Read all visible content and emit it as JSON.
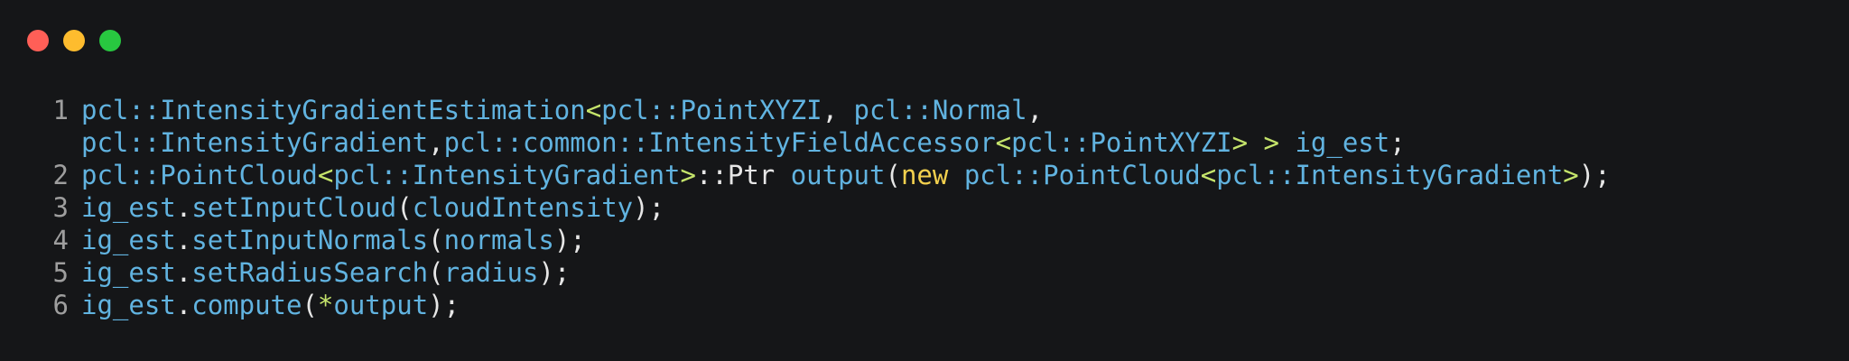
{
  "window": {
    "traffic_lights": [
      {
        "name": "close",
        "color": "#ff5f57"
      },
      {
        "name": "minimize",
        "color": "#febc2e"
      },
      {
        "name": "maximize",
        "color": "#28c840"
      }
    ]
  },
  "colors": {
    "background": "#151618",
    "line_number": "#9e9e9e",
    "identifier": "#61b3e0",
    "punctuation": "#e6e6e6",
    "angle": "#c5e46b",
    "keyword": "#f2d04e",
    "operator": "#c5e46b"
  },
  "code": {
    "lines": [
      {
        "number": "1",
        "tokens": [
          {
            "t": "pcl::IntensityGradientEstimation",
            "c": "identifier"
          },
          {
            "t": "<",
            "c": "angle"
          },
          {
            "t": "pcl::PointXYZI",
            "c": "identifier"
          },
          {
            "t": ", ",
            "c": "punctuation"
          },
          {
            "t": "pcl::Normal",
            "c": "identifier"
          },
          {
            "t": ",",
            "c": "punctuation"
          }
        ]
      },
      {
        "number": "",
        "tokens": [
          {
            "t": "pcl::IntensityGradient",
            "c": "identifier"
          },
          {
            "t": ",",
            "c": "punctuation"
          },
          {
            "t": "pcl::common::IntensityFieldAccessor",
            "c": "identifier"
          },
          {
            "t": "<",
            "c": "angle"
          },
          {
            "t": "pcl::PointXYZI",
            "c": "identifier"
          },
          {
            "t": ">",
            "c": "angle"
          },
          {
            "t": " ",
            "c": "punctuation"
          },
          {
            "t": ">",
            "c": "angle"
          },
          {
            "t": " ",
            "c": "punctuation"
          },
          {
            "t": "ig_est",
            "c": "identifier"
          },
          {
            "t": ";",
            "c": "punctuation"
          }
        ]
      },
      {
        "number": "2",
        "tokens": [
          {
            "t": "pcl::PointCloud",
            "c": "identifier"
          },
          {
            "t": "<",
            "c": "angle"
          },
          {
            "t": "pcl::IntensityGradient",
            "c": "identifier"
          },
          {
            "t": ">",
            "c": "angle"
          },
          {
            "t": "::Ptr ",
            "c": "punctuation"
          },
          {
            "t": "output",
            "c": "identifier"
          },
          {
            "t": "(",
            "c": "punctuation"
          },
          {
            "t": "new",
            "c": "keyword"
          },
          {
            "t": " ",
            "c": "punctuation"
          },
          {
            "t": "pcl::PointCloud",
            "c": "identifier"
          },
          {
            "t": "<",
            "c": "angle"
          },
          {
            "t": "pcl::IntensityGradient",
            "c": "identifier"
          },
          {
            "t": ">",
            "c": "angle"
          },
          {
            "t": ");",
            "c": "punctuation"
          }
        ]
      },
      {
        "number": "3",
        "tokens": [
          {
            "t": "ig_est",
            "c": "identifier"
          },
          {
            "t": ".",
            "c": "punctuation"
          },
          {
            "t": "setInputCloud",
            "c": "identifier"
          },
          {
            "t": "(",
            "c": "punctuation"
          },
          {
            "t": "cloudIntensity",
            "c": "identifier"
          },
          {
            "t": ");",
            "c": "punctuation"
          }
        ]
      },
      {
        "number": "4",
        "tokens": [
          {
            "t": "ig_est",
            "c": "identifier"
          },
          {
            "t": ".",
            "c": "punctuation"
          },
          {
            "t": "setInputNormals",
            "c": "identifier"
          },
          {
            "t": "(",
            "c": "punctuation"
          },
          {
            "t": "normals",
            "c": "identifier"
          },
          {
            "t": ");",
            "c": "punctuation"
          }
        ]
      },
      {
        "number": "5",
        "tokens": [
          {
            "t": "ig_est",
            "c": "identifier"
          },
          {
            "t": ".",
            "c": "punctuation"
          },
          {
            "t": "setRadiusSearch",
            "c": "identifier"
          },
          {
            "t": "(",
            "c": "punctuation"
          },
          {
            "t": "radius",
            "c": "identifier"
          },
          {
            "t": ");",
            "c": "punctuation"
          }
        ]
      },
      {
        "number": "6",
        "tokens": [
          {
            "t": "ig_est",
            "c": "identifier"
          },
          {
            "t": ".",
            "c": "punctuation"
          },
          {
            "t": "compute",
            "c": "identifier"
          },
          {
            "t": "(",
            "c": "punctuation"
          },
          {
            "t": "*",
            "c": "operator"
          },
          {
            "t": "output",
            "c": "identifier"
          },
          {
            "t": ");",
            "c": "punctuation"
          }
        ]
      }
    ]
  }
}
